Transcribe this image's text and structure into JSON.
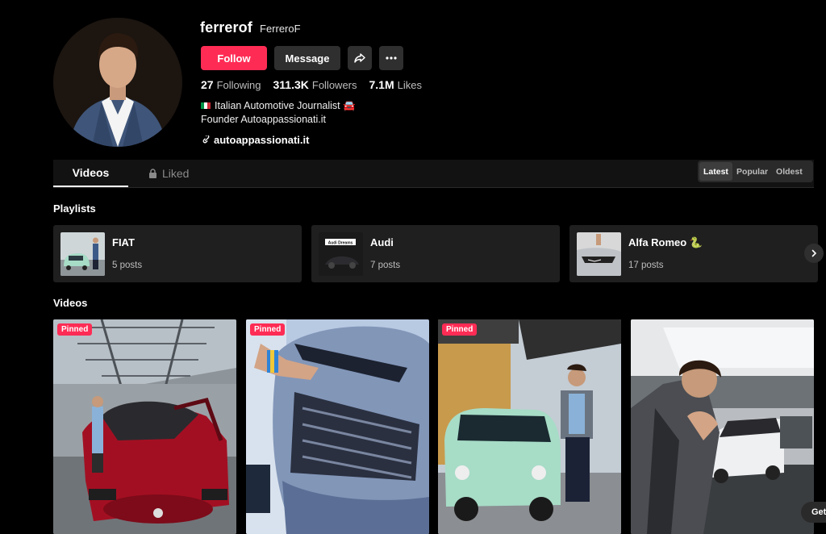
{
  "profile": {
    "username": "ferrerof",
    "nickname": "FerreroF",
    "follow_label": "Follow",
    "message_label": "Message",
    "stats": [
      {
        "value": "27",
        "label": "Following"
      },
      {
        "value": "311.3K",
        "label": "Followers"
      },
      {
        "value": "7.1M",
        "label": "Likes"
      }
    ],
    "bio_line1": "Italian Automotive Journalist 🚘",
    "bio_line2": "Founder Autoappassionati.it",
    "link": "autoappassionati.it"
  },
  "tabs": {
    "videos": "Videos",
    "liked": "Liked"
  },
  "sort": {
    "latest": "Latest",
    "popular": "Popular",
    "oldest": "Oldest",
    "selected": "Latest"
  },
  "playlists_heading": "Playlists",
  "playlists": [
    {
      "name": "FIAT",
      "count": "5 posts"
    },
    {
      "name": "Audi",
      "count": "7 posts",
      "thumb_text": "Audi Dreams"
    },
    {
      "name": "Alfa Romeo 🐍",
      "count": "17 posts"
    }
  ],
  "videos_heading": "Videos",
  "videos": [
    {
      "badge": "Pinned"
    },
    {
      "badge": "Pinned"
    },
    {
      "badge": "Pinned"
    },
    {
      "badge": ""
    }
  ],
  "get_app": "Get",
  "colors": {
    "accent": "#fe2c55",
    "button": "#2f2f2f",
    "background": "#000000",
    "card": "#1f1f1f"
  }
}
